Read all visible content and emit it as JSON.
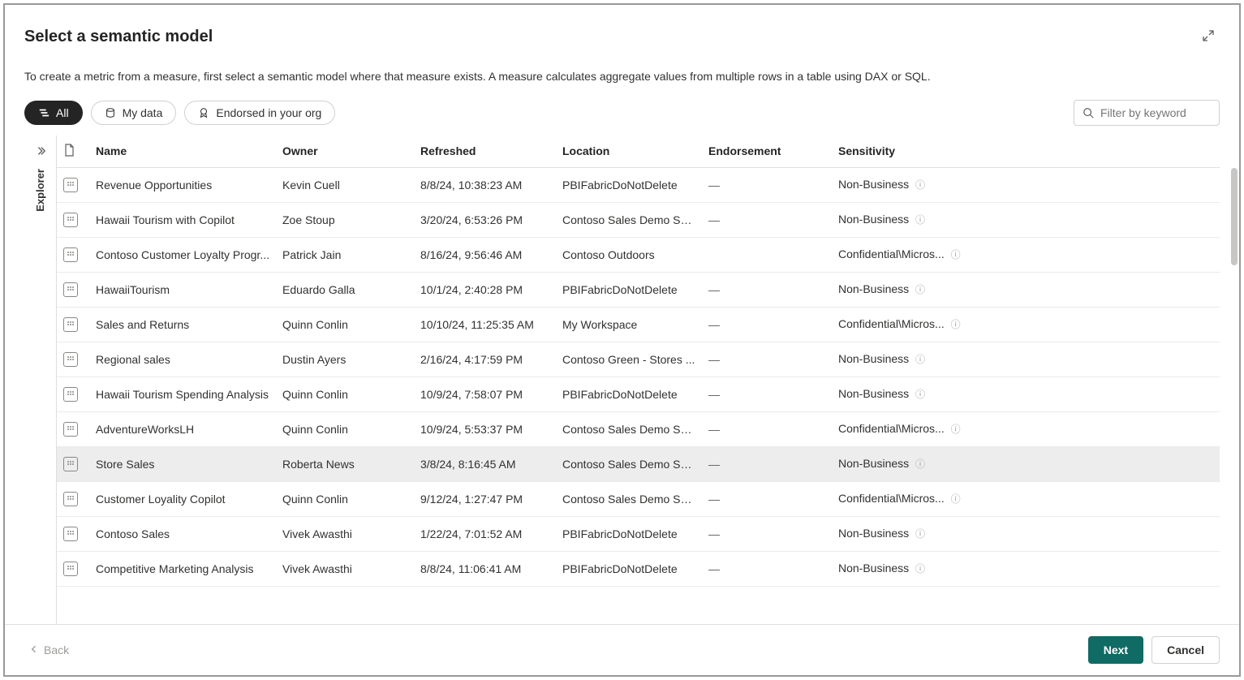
{
  "dialog": {
    "title": "Select a semantic model",
    "description": "To create a metric from a measure, first select a semantic model where that measure exists. A measure calculates aggregate values from multiple rows in a table using DAX or SQL."
  },
  "filters": {
    "all": "All",
    "my_data": "My data",
    "endorsed": "Endorsed in your org"
  },
  "search": {
    "placeholder": "Filter by keyword"
  },
  "rail": {
    "label": "Explorer"
  },
  "columns": {
    "name": "Name",
    "owner": "Owner",
    "refreshed": "Refreshed",
    "location": "Location",
    "endorsement": "Endorsement",
    "sensitivity": "Sensitivity"
  },
  "rows": [
    {
      "name": "Revenue Opportunities",
      "owner": "Kevin Cuell",
      "refreshed": "8/8/24, 10:38:23 AM",
      "location": "PBIFabricDoNotDelete",
      "endorsement": "—",
      "sensitivity": "Non-Business",
      "selected": false
    },
    {
      "name": "Hawaii Tourism with Copilot",
      "owner": "Zoe Stoup",
      "refreshed": "3/20/24, 6:53:26 PM",
      "location": "Contoso Sales Demo Sp...",
      "endorsement": "—",
      "sensitivity": "Non-Business",
      "selected": false
    },
    {
      "name": "Contoso Customer Loyalty Progr...",
      "owner": "Patrick Jain",
      "refreshed": "8/16/24, 9:56:46 AM",
      "location": "Contoso Outdoors",
      "endorsement": "",
      "sensitivity": "Confidential\\Micros...",
      "selected": false
    },
    {
      "name": "HawaiiTourism",
      "owner": "Eduardo Galla",
      "refreshed": "10/1/24, 2:40:28 PM",
      "location": "PBIFabricDoNotDelete",
      "endorsement": "—",
      "sensitivity": "Non-Business",
      "selected": false
    },
    {
      "name": "Sales and Returns",
      "owner": "Quinn Conlin",
      "refreshed": "10/10/24, 11:25:35 AM",
      "location": "My Workspace",
      "endorsement": "—",
      "sensitivity": "Confidential\\Micros...",
      "selected": false
    },
    {
      "name": "Regional sales",
      "owner": "Dustin Ayers",
      "refreshed": "2/16/24, 4:17:59 PM",
      "location": "Contoso Green - Stores ...",
      "endorsement": "—",
      "sensitivity": "Non-Business",
      "selected": false
    },
    {
      "name": "Hawaii Tourism Spending Analysis",
      "owner": "Quinn Conlin",
      "refreshed": "10/9/24, 7:58:07 PM",
      "location": "PBIFabricDoNotDelete",
      "endorsement": "—",
      "sensitivity": "Non-Business",
      "selected": false
    },
    {
      "name": "AdventureWorksLH",
      "owner": "Quinn Conlin",
      "refreshed": "10/9/24, 5:53:37 PM",
      "location": "Contoso Sales Demo Sp...",
      "endorsement": "—",
      "sensitivity": "Confidential\\Micros...",
      "selected": false
    },
    {
      "name": "Store Sales",
      "owner": "Roberta News",
      "refreshed": "3/8/24, 8:16:45 AM",
      "location": "Contoso Sales Demo Sp...",
      "endorsement": "—",
      "sensitivity": "Non-Business",
      "selected": true
    },
    {
      "name": "Customer Loyality Copilot",
      "owner": "Quinn Conlin",
      "refreshed": "9/12/24, 1:27:47 PM",
      "location": "Contoso Sales Demo Sp...",
      "endorsement": "—",
      "sensitivity": "Confidential\\Micros...",
      "selected": false
    },
    {
      "name": "Contoso Sales",
      "owner": "Vivek Awasthi",
      "refreshed": "1/22/24, 7:01:52 AM",
      "location": "PBIFabricDoNotDelete",
      "endorsement": "—",
      "sensitivity": "Non-Business",
      "selected": false
    },
    {
      "name": "Competitive Marketing Analysis",
      "owner": "Vivek Awasthi",
      "refreshed": "8/8/24, 11:06:41 AM",
      "location": "PBIFabricDoNotDelete",
      "endorsement": "—",
      "sensitivity": "Non-Business",
      "selected": false
    }
  ],
  "footer": {
    "back": "Back",
    "next": "Next",
    "cancel": "Cancel"
  }
}
